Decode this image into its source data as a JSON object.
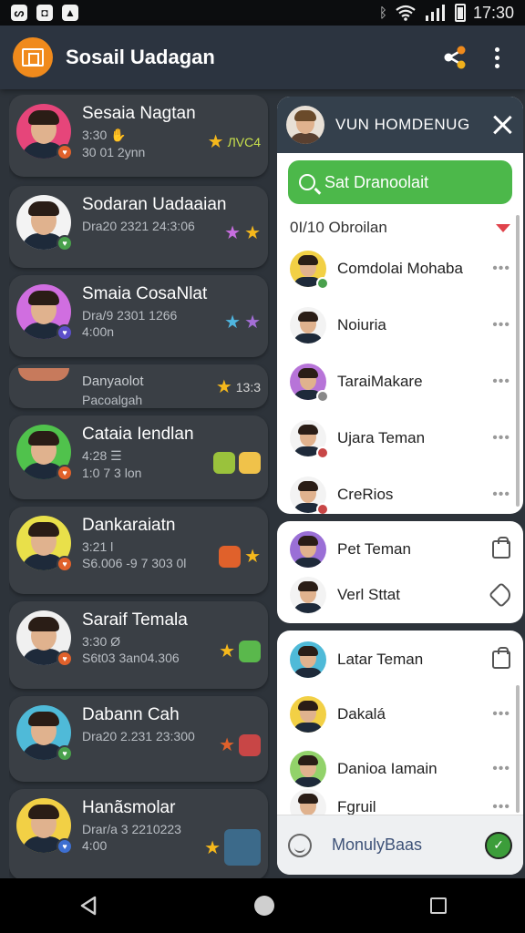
{
  "status_bar": {
    "time": "17:30"
  },
  "app_bar": {
    "title": "Sosail Uadagan"
  },
  "chats": [
    {
      "name": "Sesaia Nagtan",
      "sub": "3:30 ✋",
      "sub2": "30 01 2ynn",
      "tag": "ЛVC4",
      "tag_color": "#c8e04c",
      "avatar_bg": "#e6457a",
      "badge_bg": "#e0612b"
    },
    {
      "name": "Sodaran Uadaaian",
      "sub": "Dra20 2321 24:3:06",
      "sub2": "",
      "tag": "",
      "tag_color": "#f5b81c",
      "avatar_bg": "#f3f3f3",
      "badge_bg": "#49a04c"
    },
    {
      "name": "Smaia CosaNlat",
      "sub": "Dra/9 2301 1266",
      "sub2": "4:00n",
      "tag": "",
      "tag_color": "#f5b81c",
      "avatar_bg": "#d06ee0",
      "badge_bg": "#5b4fc9"
    },
    {
      "name": "Danyaolot",
      "sub": "Pacoalgah",
      "sub2": "",
      "tag": "13:3",
      "tag_color": "#d5d5d5",
      "avatar_bg": "#c77a5c",
      "badge_bg": "#c84646"
    },
    {
      "name": "Cataia Iendlan",
      "sub": "4:28 ☰",
      "sub2": "1:0 7 3 lon",
      "tag": "",
      "tag_color": "#f5b81c",
      "avatar_bg": "#50c24c",
      "badge_bg": "#e0612b"
    },
    {
      "name": "Dankaraiatn",
      "sub": "3:21 l",
      "sub2": "S6.006 -9 7 303 0l",
      "tag": "",
      "tag_color": "#f5b81c",
      "avatar_bg": "#e9e04a",
      "badge_bg": "#e0612b"
    },
    {
      "name": "Saraif Temala",
      "sub": "3:30 Ø",
      "sub2": "S6t03 3an04.306",
      "tag": "",
      "tag_color": "#f5b81c",
      "avatar_bg": "#f0f0f0",
      "badge_bg": "#e0612b"
    },
    {
      "name": "Dabann Cah",
      "sub": "Dra20 2.231 23:300",
      "sub2": "",
      "tag": "",
      "tag_color": "#f5b81c",
      "avatar_bg": "#4fbad8",
      "badge_bg": "#49a04c"
    },
    {
      "name": "Hanãsmolar",
      "sub": "Drar/a 3 2210223",
      "sub2": "4:00",
      "tag": "",
      "tag_color": "#f5b81c",
      "avatar_bg": "#f2d045",
      "badge_bg": "#3d6fd1"
    }
  ],
  "panel": {
    "title": "VUN HOMDENUG",
    "search_label": "Sat Dranoolait",
    "section_header": "0I/10 Obroilan",
    "contacts": [
      {
        "name": "Comdolai Mohaba",
        "avatar_bg": "#f2d045",
        "badge_bg": "#49a04c"
      },
      {
        "name": "Noiuria",
        "avatar_bg": "#f3f3f3",
        "badge_bg": ""
      },
      {
        "name": "TaraiMakare",
        "avatar_bg": "#b774d8",
        "badge_bg": "#888888"
      },
      {
        "name": "Ujara Teman",
        "avatar_bg": "#f3f3f3",
        "badge_bg": "#c84646"
      },
      {
        "name": "CreRios",
        "avatar_bg": "#f3f3f3",
        "badge_bg": "#c84646"
      }
    ],
    "group2": [
      {
        "name": "Pet Teman",
        "avatar_bg": "#9a6fd6"
      },
      {
        "name": "Verl Sttat",
        "avatar_bg": "#f3f3f3"
      }
    ],
    "group3": [
      {
        "name": "Latar Teman",
        "avatar_bg": "#4fbad8"
      },
      {
        "name": "Dakalá",
        "avatar_bg": "#f2d045"
      },
      {
        "name": "Danioa Iamain",
        "avatar_bg": "#92d26a"
      },
      {
        "name": "Fgruil",
        "avatar_bg": "#f3f3f3"
      }
    ],
    "footer_text": "MonulyBaas"
  }
}
